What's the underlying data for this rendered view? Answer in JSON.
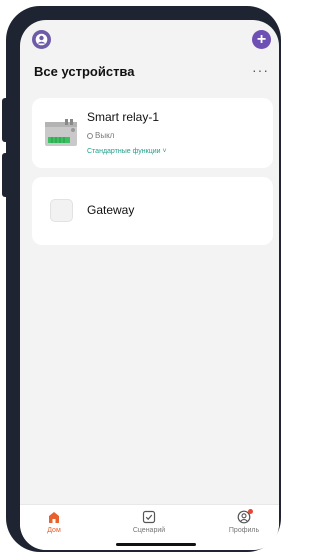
{
  "header": {
    "title": "Все устройства",
    "add_label": "+",
    "more_label": "···"
  },
  "devices": [
    {
      "name": "Smart relay-1",
      "status": "Выкл",
      "function_link": "Стандартные функции ˅",
      "icon": "relay-module-icon"
    },
    {
      "name": "Gateway",
      "icon": "gateway-icon"
    }
  ],
  "bottom_nav": [
    {
      "label": "Дом",
      "icon": "home-icon",
      "active": true
    },
    {
      "label": "Сценарий",
      "icon": "scenario-check-icon",
      "active": false
    },
    {
      "label": "Профиль",
      "icon": "profile-icon",
      "active": false
    }
  ],
  "colors": {
    "accent_purple": "#6e4fb3",
    "active_tab": "#e8602c",
    "link_green": "#1fa08a"
  }
}
